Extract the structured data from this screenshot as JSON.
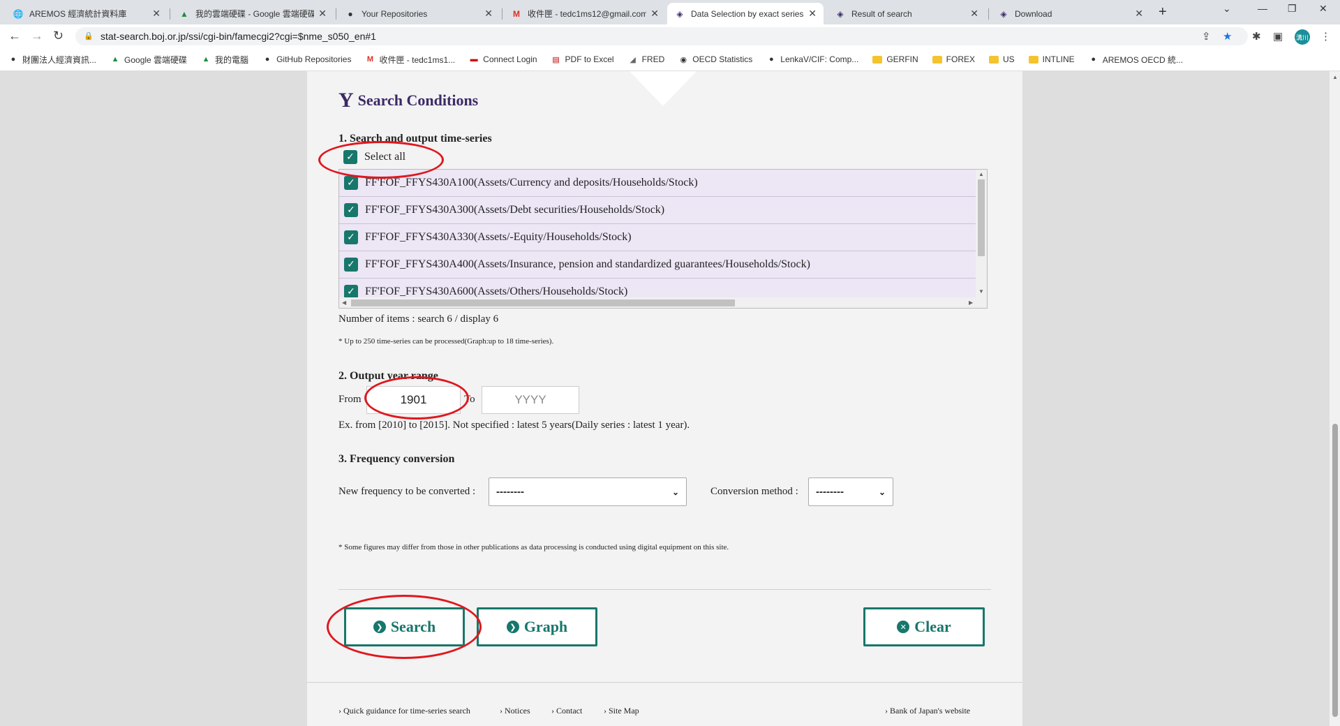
{
  "tabs": [
    {
      "label": "AREMOS 經濟統計資料庫",
      "icon": "globe-icon"
    },
    {
      "label": "我的雲端硬碟 - Google 雲端硬碟",
      "icon": "google-drive-icon"
    },
    {
      "label": "Your Repositories",
      "icon": "github-icon"
    },
    {
      "label": "收件匣 - tedc1ms12@gmail.com",
      "icon": "gmail-icon"
    },
    {
      "label": "Data Selection by exact series",
      "icon": "boj-icon"
    },
    {
      "label": "Result of search",
      "icon": "boj-icon"
    },
    {
      "label": "Download",
      "icon": "boj-icon"
    }
  ],
  "url": "stat-search.boj.or.jp/ssi/cgi-bin/famecgi2?cgi=$nme_s050_en#1",
  "bookmarks": [
    {
      "label": "財團法人經濟資訊...",
      "icon": "globe-icon"
    },
    {
      "label": "Google 雲端硬碟",
      "icon": "google-drive-icon"
    },
    {
      "label": "我的電腦",
      "icon": "google-drive-icon"
    },
    {
      "label": "GitHub Repositories",
      "icon": "github-icon"
    },
    {
      "label": "收件匣 - tedc1ms1...",
      "icon": "gmail-icon"
    },
    {
      "label": "Connect Login",
      "icon": "flag-icon"
    },
    {
      "label": "PDF to Excel",
      "icon": "pdf-icon"
    },
    {
      "label": "FRED",
      "icon": "chart-icon"
    },
    {
      "label": "OECD Statistics",
      "icon": "oecd-icon"
    },
    {
      "label": "LenkaV/CIF: Comp...",
      "icon": "github-icon"
    },
    {
      "label": "GERFIN",
      "icon": "folder-icon"
    },
    {
      "label": "FOREX",
      "icon": "folder-icon"
    },
    {
      "label": "US",
      "icon": "folder-icon"
    },
    {
      "label": "INTLINE",
      "icon": "folder-icon"
    },
    {
      "label": "AREMOS OECD 統...",
      "icon": "globe-icon"
    }
  ],
  "avatar_text": "溝川",
  "search_conditions": {
    "title": "Search Conditions",
    "section1_title": "1. Search and output time-series",
    "select_all": "Select all",
    "series": [
      "FF'FOF_FFYS430A100(Assets/Currency and deposits/Households/Stock)",
      "FF'FOF_FFYS430A300(Assets/Debt securities/Households/Stock)",
      "FF'FOF_FFYS430A330(Assets/-Equity/Households/Stock)",
      "FF'FOF_FFYS430A400(Assets/Insurance, pension and standardized guarantees/Households/Stock)",
      "FF'FOF_FFYS430A600(Assets/Others/Households/Stock)"
    ],
    "count_text": "Number of items : search 6 / display 6",
    "note1": "* Up to 250 time-series can be processed(Graph:up to 18 time-series).",
    "section2_title": "2. Output year range",
    "from_label": "From",
    "from_value": "1901",
    "to_label": "To",
    "to_placeholder": "YYYY",
    "example": "Ex. from [2010] to [2015]. Not specified : latest 5 years(Daily series : latest 1 year).",
    "section3_title": "3. Frequency conversion",
    "freq_label": "New frequency to be converted :",
    "freq_value": "--------",
    "conv_label": "Conversion method :",
    "conv_value": "--------",
    "note2": "* Some figures may differ from those in other publications as data processing is conducted using digital equipment on this site.",
    "search_button": "Search",
    "graph_button": "Graph",
    "clear_button": "Clear"
  },
  "footer": {
    "guidance": "Quick guidance for time-series search",
    "notices": "Notices",
    "contact": "Contact",
    "sitemap": "Site Map",
    "boj": "Bank of Japan's website"
  },
  "colors": {
    "accent": "#17776b",
    "title": "#3b2a66",
    "annotation": "#e0171e",
    "row_bg": "#ece6f5"
  }
}
